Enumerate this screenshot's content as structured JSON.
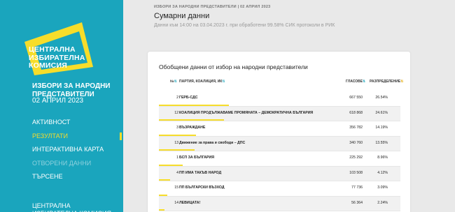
{
  "sidebar": {
    "logo_lines": [
      "ЦЕНТРАЛНА",
      "ИЗБИРАТЕЛНА",
      "КОМИСИЯ"
    ],
    "election_title": "ИЗБОРИ ЗА НАРОДНИ ПРЕДСТАВИТЕЛИ",
    "election_date": "02 АПРИЛ 2023",
    "nav": [
      {
        "label": "Активност",
        "state": "normal"
      },
      {
        "label": "Резултати",
        "state": "active"
      },
      {
        "label": "Интерактивна карта",
        "state": "normal"
      },
      {
        "label": "Отворени данни",
        "state": "disabled"
      },
      {
        "label": "Търсене",
        "state": "normal"
      }
    ],
    "footer": "Централна избирателна комисия",
    "colors": {
      "bg": "#1aa5bd",
      "accent": "#f7dd2a",
      "logo": "#f7dd2a"
    }
  },
  "main": {
    "breadcrumb": "ИЗБОРИ ЗА НАРОДНИ ПРЕДСТАВИТЕЛИ | 02 АПРИЛ 2023",
    "title": "Сумарни данни",
    "subtitle": "Данни към 14:00 на 03.04.2023 г. при обработени 99.58% СИК протоколи в РИК"
  },
  "card": {
    "title": "Обобщени данни от избор на народни представители",
    "headers": {
      "num": "№",
      "party": "ПАРТИЯ, КОАЛИЦИЯ, ИК",
      "votes": "ГЛАСОВЕ",
      "distribution": "РАЗПРЕДЕЛЕНИЕ"
    },
    "sort_icons": {
      "num": "sort-icon",
      "party": "sort-icon",
      "votes": "sort-icon",
      "distribution": "sort-active-icon"
    },
    "rows": [
      {
        "num": "2",
        "party": "ГЕРБ-СДС",
        "votes": "667 550",
        "pct": "26.54%",
        "share": 26.54
      },
      {
        "num": "12",
        "party": "КОАЛИЦИЯ ПРОДЪЛЖАВАМЕ ПРОМЯНАТА – ДЕМОКРАТИЧНА БЪЛГАРИЯ",
        "votes": "618 868",
        "pct": "24.61%",
        "share": 24.61
      },
      {
        "num": "3",
        "party": "ВЪЗРАЖДАНЕ",
        "votes": "356 782",
        "pct": "14.19%",
        "share": 14.19
      },
      {
        "num": "13",
        "party": "Движение за права и свободи – ДПС",
        "votes": "340 760",
        "pct": "13.55%",
        "share": 13.55
      },
      {
        "num": "1",
        "party": "БСП ЗА БЪЛГАРИЯ",
        "votes": "225 292",
        "pct": "8.96%",
        "share": 8.96
      },
      {
        "num": "4",
        "party": "ПП ИМА ТАКЪВ НАРОД",
        "votes": "103 508",
        "pct": "4.12%",
        "share": 4.12
      },
      {
        "num": "15",
        "party": "ПП БЪЛГАРСКИ ВЪЗХОД",
        "votes": "77 736",
        "pct": "3.09%",
        "share": 3.09
      },
      {
        "num": "14",
        "party": "ЛЕВИЦАТА!",
        "votes": "56 364",
        "pct": "2.24%",
        "share": 2.24
      }
    ]
  }
}
